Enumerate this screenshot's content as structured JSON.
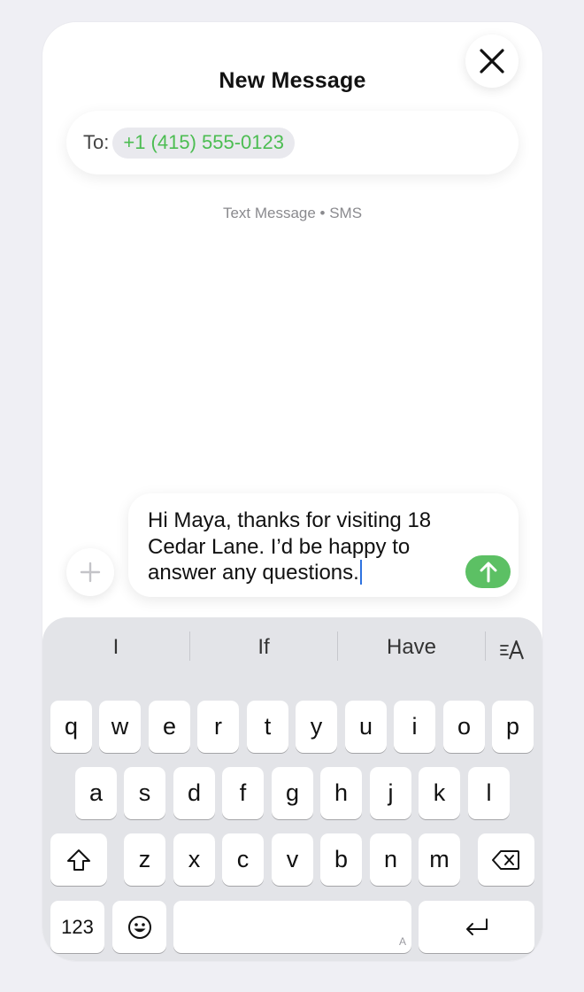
{
  "header": {
    "title": "New Message"
  },
  "recipient": {
    "label": "To:",
    "value": "+1 (415) 555-0123"
  },
  "service_label": "Text Message • SMS",
  "compose": {
    "text": "Hi Maya, thanks for visiting 18 Cedar Lane. I’d be happy to answer any questions."
  },
  "keyboard": {
    "suggestions": [
      "I",
      "If",
      "Have"
    ],
    "row1": [
      "q",
      "w",
      "e",
      "r",
      "t",
      "y",
      "u",
      "i",
      "o",
      "p"
    ],
    "row2": [
      "a",
      "s",
      "d",
      "f",
      "g",
      "h",
      "j",
      "k",
      "l"
    ],
    "row3": [
      "z",
      "x",
      "c",
      "v",
      "b",
      "n",
      "m"
    ],
    "numbers_key": "123",
    "space_hint": "A"
  },
  "colors": {
    "accent_green": "#5cc064",
    "recipient_green": "#4cbd52",
    "caret_blue": "#2f73e0"
  }
}
